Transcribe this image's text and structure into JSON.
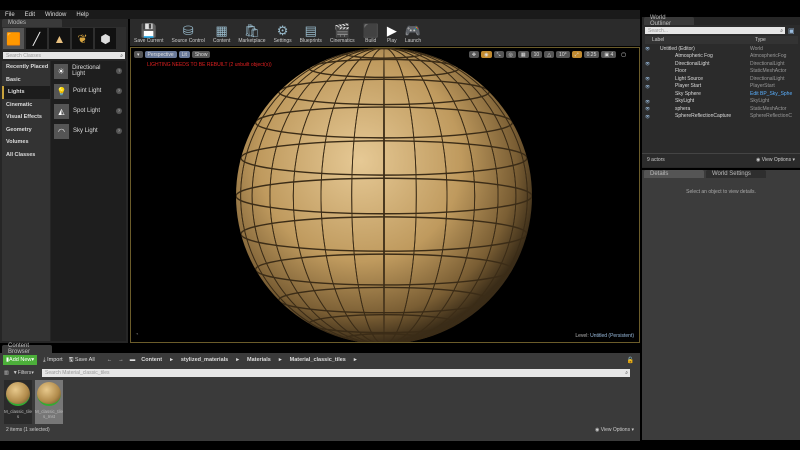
{
  "menu": [
    "File",
    "Edit",
    "Window",
    "Help"
  ],
  "modes": {
    "tab": "Modes",
    "search_placeholder": "Search Classes",
    "categories": [
      "Recently Placed",
      "Basic",
      "Lights",
      "Cinematic",
      "Visual Effects",
      "Geometry",
      "Volumes",
      "All Classes"
    ],
    "selected_category": "Lights",
    "items": [
      {
        "label": "Directional Light",
        "icon": "directional-light-icon"
      },
      {
        "label": "Point Light",
        "icon": "point-light-icon"
      },
      {
        "label": "Spot Light",
        "icon": "spot-light-icon"
      },
      {
        "label": "Sky Light",
        "icon": "sky-light-icon"
      }
    ]
  },
  "toolbar": [
    {
      "label": "Save Current",
      "icon": "save-icon"
    },
    {
      "label": "Source Control",
      "icon": "source-control-icon"
    },
    {
      "label": "Content",
      "icon": "content-icon"
    },
    {
      "label": "Marketplace",
      "icon": "marketplace-icon"
    },
    {
      "label": "Settings",
      "icon": "settings-icon"
    },
    {
      "label": "Blueprints",
      "icon": "blueprints-icon"
    },
    {
      "label": "Cinematics",
      "icon": "cinematics-icon"
    },
    {
      "label": "Build",
      "icon": "build-icon"
    },
    {
      "label": "Play",
      "icon": "play-icon"
    },
    {
      "label": "Launch",
      "icon": "launch-icon"
    }
  ],
  "viewport": {
    "perspective": "Perspective",
    "lit": "Lit",
    "show": "Show",
    "warning": "LIGHTING NEEDS TO BE REBUILT (2 unbuilt object(s))",
    "grid": "10",
    "angle": "10°",
    "scale": "0.25",
    "camera_speed": "4",
    "level_label": "Level:",
    "level_name": "Untitled (Persistent)",
    "warning_color": "#e02020"
  },
  "outliner": {
    "tab": "World Outliner",
    "search_placeholder": "Search...",
    "col_label": "Label",
    "col_type": "Type",
    "rows": [
      {
        "label": "Untitled (Editor)",
        "type": "World"
      },
      {
        "label": "Atmospheric Fog",
        "type": "AtmosphericFog"
      },
      {
        "label": "DirectionalLight",
        "type": "DirectionalLight"
      },
      {
        "label": "Floor",
        "type": "StaticMeshActor"
      },
      {
        "label": "Light Source",
        "type": "DirectionalLight"
      },
      {
        "label": "Player Start",
        "type": "PlayerStart"
      },
      {
        "label": "Sky Sphere",
        "type": "Edit BP_Sky_Sphe"
      },
      {
        "label": "SkyLight",
        "type": "SkyLight"
      },
      {
        "label": "sphera",
        "type": "StaticMeshActor"
      },
      {
        "label": "SphereReflectionCapture",
        "type": "SphereReflectionC"
      }
    ],
    "count": "9 actors",
    "view_options": "View Options"
  },
  "details": {
    "tab": "Details",
    "tab2": "World Settings",
    "empty": "Select an object to view details."
  },
  "content_browser": {
    "tab": "Content Browser",
    "add_new": "Add New",
    "import": "Import",
    "save_all": "Save All",
    "filters": "Filters",
    "breadcrumb": [
      "Content",
      "stylized_materials",
      "Materials",
      "Material_classic_tiles"
    ],
    "search_placeholder": "Search Material_classic_tiles",
    "assets": [
      {
        "label": "M_classic_tiles",
        "selected": false
      },
      {
        "label": "M_classic_tiles_Inst",
        "selected": true
      }
    ],
    "status": "2 items (1 selected)",
    "view_options": "View Options",
    "accent": "#4caf3a"
  }
}
